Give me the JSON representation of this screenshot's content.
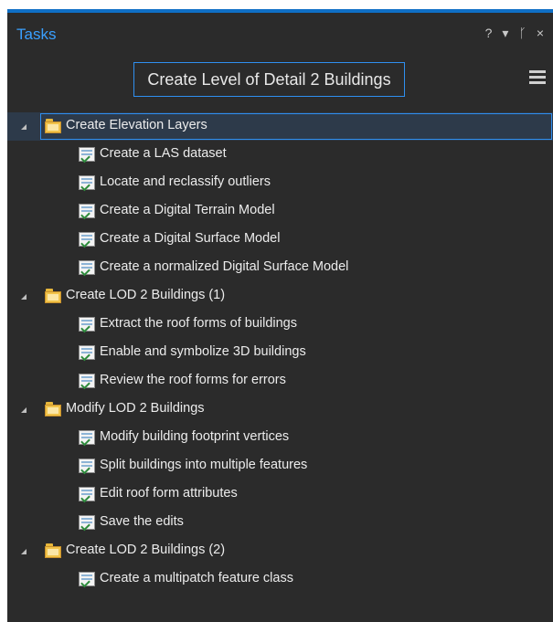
{
  "pane": {
    "title": "Tasks",
    "controls": {
      "help": "?",
      "dropdown": "▾",
      "pin": "ᚴ",
      "close": "×"
    }
  },
  "task": {
    "title": "Create Level of Detail 2 Buildings",
    "menu_icon": "hamburger-menu-icon"
  },
  "groups": [
    {
      "label": "Create Elevation Layers",
      "selected": true,
      "tasks": [
        "Create a LAS dataset",
        "Locate and reclassify outliers",
        "Create a Digital Terrain Model",
        "Create a Digital Surface Model",
        "Create a normalized Digital Surface Model"
      ]
    },
    {
      "label": "Create LOD 2 Buildings (1)",
      "selected": false,
      "tasks": [
        "Extract the roof forms of buildings",
        "Enable and symbolize 3D buildings",
        "Review the roof forms for errors"
      ]
    },
    {
      "label": "Modify LOD 2 Buildings",
      "selected": false,
      "tasks": [
        "Modify building footprint vertices",
        "Split buildings into multiple features",
        "Edit roof form attributes",
        "Save the edits"
      ]
    },
    {
      "label": "Create LOD 2 Buildings (2)",
      "selected": false,
      "tasks": [
        "Create a multipatch feature class"
      ]
    }
  ],
  "colors": {
    "pane_background": "#2b2b2b",
    "accent_blue": "#0f6fc6",
    "title_blue": "#3aa0ff",
    "text": "#ececec",
    "folder_yellow": "#f1c34a"
  }
}
